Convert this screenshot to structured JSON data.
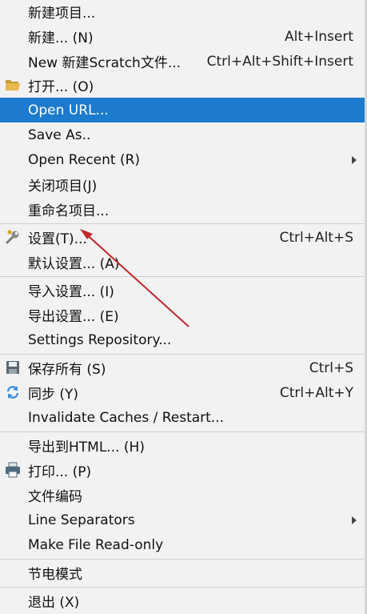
{
  "menu": {
    "items": [
      {
        "label": "新建项目...",
        "shortcut": ""
      },
      {
        "label": "新建... (N)",
        "shortcut": "Alt+Insert"
      },
      {
        "label": "New 新建Scratch文件...",
        "shortcut": "Ctrl+Alt+Shift+Insert"
      },
      {
        "label": "打开... (O)",
        "shortcut": "",
        "icon": "folder-open-icon"
      },
      {
        "label": "Open URL...",
        "shortcut": "",
        "selected": true
      },
      {
        "label": "Save As..",
        "shortcut": ""
      },
      {
        "label": "Open Recent (R)",
        "shortcut": "",
        "submenu": true
      },
      {
        "label": "关闭项目(J)",
        "shortcut": ""
      },
      {
        "label": "重命名项目...",
        "shortcut": ""
      },
      {
        "label": "设置(T)...",
        "shortcut": "Ctrl+Alt+S",
        "icon": "wrench-icon"
      },
      {
        "label": "默认设置... (A)",
        "shortcut": ""
      },
      {
        "label": "导入设置... (I)",
        "shortcut": ""
      },
      {
        "label": "导出设置... (E)",
        "shortcut": ""
      },
      {
        "label": "Settings Repository...",
        "shortcut": ""
      },
      {
        "label": "保存所有 (S)",
        "shortcut": "Ctrl+S",
        "icon": "save-icon"
      },
      {
        "label": "同步 (Y)",
        "shortcut": "Ctrl+Alt+Y",
        "icon": "sync-icon"
      },
      {
        "label": "Invalidate Caches / Restart...",
        "shortcut": ""
      },
      {
        "label": "导出到HTML... (H)",
        "shortcut": ""
      },
      {
        "label": "打印... (P)",
        "shortcut": "",
        "icon": "printer-icon"
      },
      {
        "label": "文件编码",
        "shortcut": ""
      },
      {
        "label": "Line Separators",
        "shortcut": "",
        "submenu": true
      },
      {
        "label": "Make File Read-only",
        "shortcut": ""
      },
      {
        "label": "节电模式",
        "shortcut": ""
      },
      {
        "label": "退出 (X)",
        "shortcut": ""
      }
    ]
  },
  "colors": {
    "selection": "#1c7bcf",
    "annotation_arrow": "#c0282a",
    "background": "#f2f2f2"
  }
}
